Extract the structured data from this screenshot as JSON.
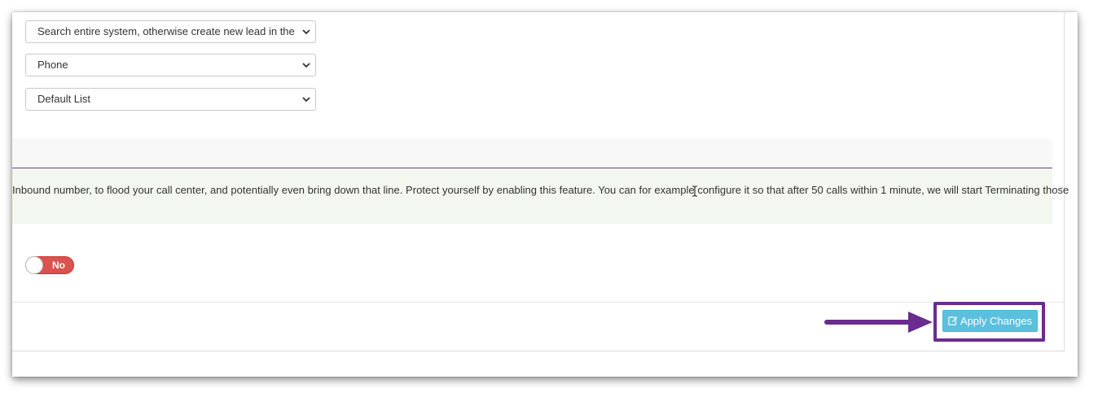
{
  "form": {
    "selects": [
      {
        "value": "Search entire system, otherwise create new lead in the Default List"
      },
      {
        "value": "Phone"
      },
      {
        "value": "Default List"
      }
    ]
  },
  "flood_protection": {
    "description": "Inbound number, to flood your call center, and potentially even bring down that line. Protect yourself by enabling this feature. You can for example configure it so that after 50 calls within 1 minute, we will start Terminating those",
    "toggle_label": "No",
    "toggle_state_on": false
  },
  "footer": {
    "apply_label": "Apply Changes",
    "apply_icon": "edit-icon"
  },
  "colors": {
    "toggle_off": "#d9534f",
    "button_info": "#5bc0de",
    "annotation_purple": "#6a2c8e",
    "section_rule": "#6e3b8e",
    "info_band": "#f2f7ef"
  }
}
